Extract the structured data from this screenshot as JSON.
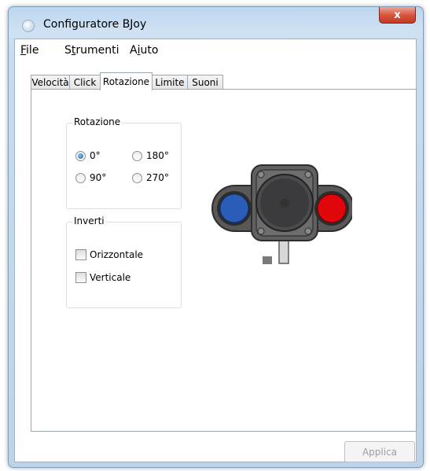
{
  "window": {
    "title": "Configuratore BJoy",
    "close_glyph": "x"
  },
  "menu": [
    {
      "mnemonic": "F",
      "rest": "ile"
    },
    {
      "pre": "S",
      "mnemonic": "t",
      "rest": "rumenti"
    },
    {
      "pre": "A",
      "mnemonic": "i",
      "rest": "uto"
    }
  ],
  "tabs": [
    "Velocità",
    "Click",
    "Rotazione",
    "Limite",
    "Suoni"
  ],
  "active_tab": "Rotazione",
  "rotation_group": {
    "label": "Rotazione",
    "options": [
      {
        "label": "0°",
        "checked": true
      },
      {
        "label": "180°",
        "checked": false
      },
      {
        "label": "90°",
        "checked": false
      },
      {
        "label": "270°",
        "checked": false
      }
    ]
  },
  "invert_group": {
    "label": "Inverti",
    "options": [
      {
        "label": "Orizzontale",
        "checked": false
      },
      {
        "label": "Verticale",
        "checked": false
      }
    ]
  },
  "apply_label": "Applica",
  "colors": {
    "left_button": "#2a5db8",
    "right_button": "#e0060a",
    "stick": "#3b3b3d"
  }
}
